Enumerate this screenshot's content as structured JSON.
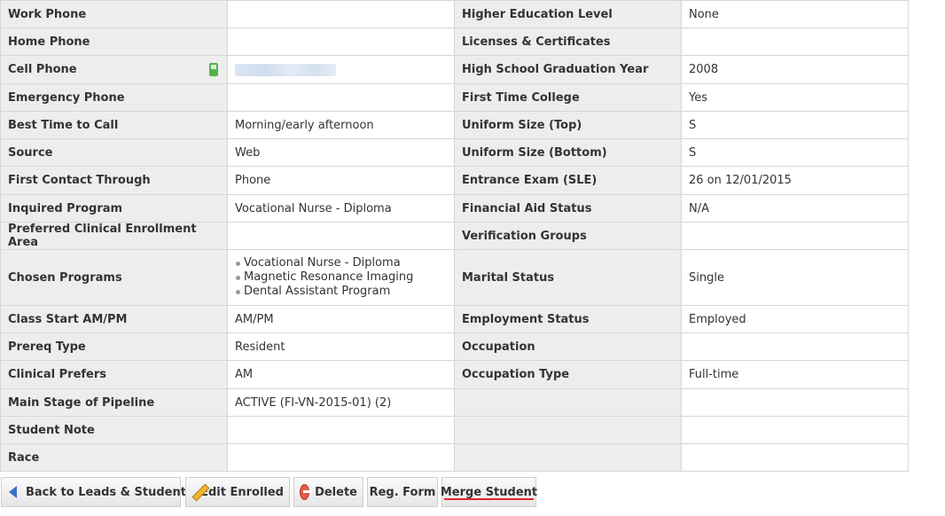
{
  "rows": [
    {
      "l1": "Work Phone",
      "v1": "",
      "l2": "Higher Education Level",
      "v2": "None"
    },
    {
      "l1": "Home Phone",
      "v1": "",
      "l2": "Licenses & Certificates",
      "v2": ""
    },
    {
      "l1": "Cell Phone",
      "v1": "",
      "l2": "High School Graduation Year",
      "v2": "2008"
    },
    {
      "l1": "Emergency Phone",
      "v1": "",
      "l2": "First Time College",
      "v2": "Yes"
    },
    {
      "l1": "Best Time to Call",
      "v1": "Morning/early afternoon",
      "l2": "Uniform Size (Top)",
      "v2": "S"
    },
    {
      "l1": "Source",
      "v1": "Web",
      "l2": "Uniform Size (Bottom)",
      "v2": "S"
    },
    {
      "l1": "First Contact Through",
      "v1": "Phone",
      "l2": "Entrance Exam (SLE)",
      "v2": "26 on 12/01/2015"
    },
    {
      "l1": "Inquired Program",
      "v1": "Vocational Nurse - Diploma",
      "l2": "Financial Aid Status",
      "v2": "N/A"
    },
    {
      "l1": "Preferred Clinical Enrollment Area",
      "v1": "",
      "l2": "Verification Groups",
      "v2": ""
    },
    {
      "l1": "Chosen Programs",
      "v1": "",
      "l2": "Marital Status",
      "v2": "Single"
    },
    {
      "l1": "Class Start AM/PM",
      "v1": "AM/PM",
      "l2": "Employment Status",
      "v2": "Employed"
    },
    {
      "l1": "Prereq Type",
      "v1": "Resident",
      "l2": "Occupation",
      "v2": ""
    },
    {
      "l1": "Clinical Prefers",
      "v1": "AM",
      "l2": "Occupation Type",
      "v2": "Full-time"
    },
    {
      "l1": "Main Stage of Pipeline",
      "v1": "ACTIVE (FI-VN-2015-01) (2)",
      "l2": "",
      "v2": ""
    },
    {
      "l1": "Student Note",
      "v1": "",
      "l2": "",
      "v2": ""
    },
    {
      "l1": "Race",
      "v1": "",
      "l2": "",
      "v2": ""
    }
  ],
  "chosen_programs": [
    "Vocational Nurse - Diploma",
    "Magnetic Resonance Imaging",
    "Dental Assistant Program"
  ],
  "buttons": {
    "back": "Back to Leads & Students",
    "edit": "Edit Enrolled",
    "delete": "Delete",
    "reg_form": "Reg. Form",
    "merge": "Merge Student"
  },
  "icons": {
    "cell_phone": "cell-phone-icon",
    "back": "back-arrow-icon",
    "edit": "pencil-icon",
    "delete": "delete-icon"
  },
  "colors": {
    "label_bg": "#ededed",
    "border": "#d6d6d6",
    "phone_green": "#55b24a",
    "merge_underline": "#e3242b"
  }
}
